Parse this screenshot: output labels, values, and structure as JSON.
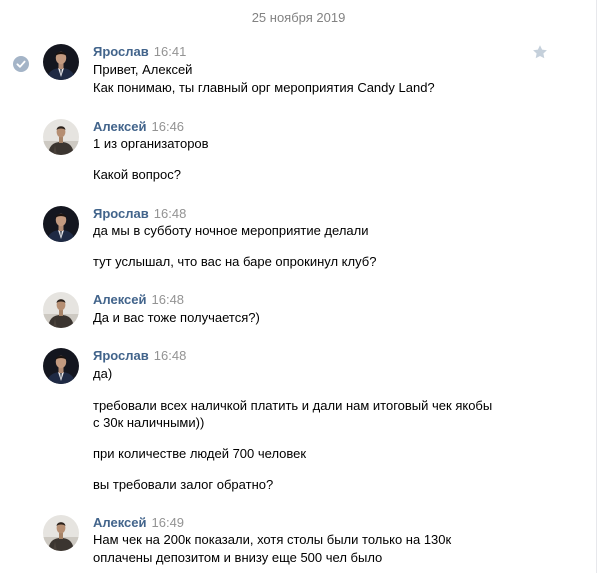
{
  "conversation": {
    "date_label": "25 ноября 2019",
    "messages": [
      {
        "author": "Ярослав",
        "time": "16:41",
        "lines": [
          "Привет, Алексей",
          "Как понимаю, ты главный орг мероприятия Candy Land?"
        ]
      },
      {
        "author": "Алексей",
        "time": "16:46",
        "lines": [
          "1 из организаторов",
          "Какой вопрос?"
        ]
      },
      {
        "author": "Ярослав",
        "time": "16:48",
        "lines": [
          "да мы в субботу ночное мероприятие делали",
          "тут услышал, что вас на баре опрокинул клуб?"
        ]
      },
      {
        "author": "Алексей",
        "time": "16:48",
        "lines": [
          "Да и вас тоже получается?)"
        ]
      },
      {
        "author": "Ярослав",
        "time": "16:48",
        "lines": [
          "да)",
          "требовали всех наличкой платить и дали нам итоговый чек якобы",
          "с 30к наличными))",
          "при количестве людей 700 человек",
          "вы требовали залог обратно?"
        ]
      },
      {
        "author": "Алексей",
        "time": "16:49",
        "lines": [
          "Нам чек на 200к показали, хотя столы были только на 130к",
          "оплачены депозитом и внизу еще 500 чел было"
        ]
      }
    ]
  },
  "icons": {
    "selected": "check-circle-icon",
    "favorite": "star-icon"
  },
  "colors": {
    "author_link": "#42648b",
    "timestamp": "#939393",
    "date_divider": "#828282",
    "check_badge": "#a4b4c7",
    "star": "#c5d0db"
  }
}
